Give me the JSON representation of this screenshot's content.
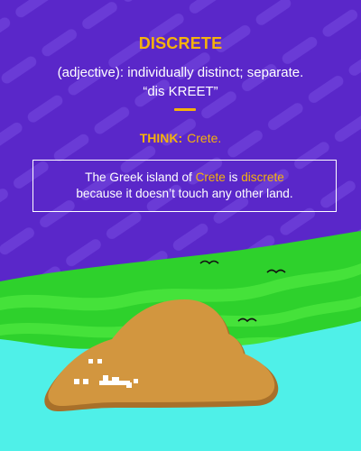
{
  "card": {
    "word": "DISCRETE",
    "definition": "(adjective): individually distinct; separate.",
    "pronunciation": "“dis KREET”",
    "think_label": "THINK:",
    "think_value": "Crete.",
    "sentence": {
      "part1": "The Greek island of ",
      "highlight1": "Crete",
      "part2": " is ",
      "highlight2": "discrete",
      "part3": "because it doesn’t touch any other land."
    }
  },
  "colors": {
    "background_purple": "#5a27c9",
    "stripe_purple": "#6a3bd6",
    "accent_gold": "#f5b20b",
    "grass_green": "#2ed12c",
    "grass_light": "#45e23a",
    "sea_cyan": "#4ff0e8",
    "island_tan": "#d2963f",
    "island_shadow": "#a8702a"
  }
}
